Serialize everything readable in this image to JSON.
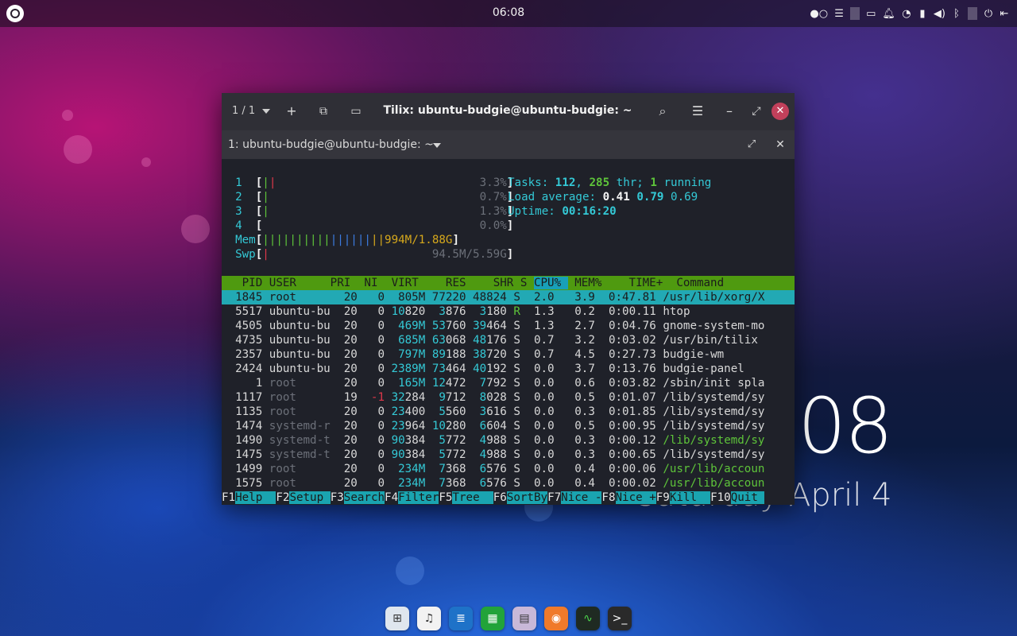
{
  "top_panel": {
    "clock": "06:08",
    "logo_icon": "budgie-menu-icon",
    "tray_icons": [
      "workspace-dots-icon",
      "raven-menu-icon",
      "folder-icon",
      "bell-icon",
      "wifi-icon",
      "battery-icon",
      "volume-icon",
      "bluetooth-icon",
      "power-icon",
      "exit-icon"
    ]
  },
  "desktop_clock": {
    "time": "08",
    "date": "Saturday April  4"
  },
  "window": {
    "session_counter": "1 / 1",
    "title": "Tilix: ubuntu-budgie@ubuntu-budgie: ~",
    "terminal_title": "1: ubuntu-budgie@ubuntu-budgie: ~"
  },
  "htop": {
    "cpus": [
      {
        "n": "1",
        "bars": "|",
        "bars2": "|",
        "pct": "3.3%"
      },
      {
        "n": "2",
        "bars": "|",
        "bars2": "",
        "pct": "0.7%"
      },
      {
        "n": "3",
        "bars": "|",
        "bars2": "",
        "pct": "1.3%"
      },
      {
        "n": "4",
        "bars": "",
        "bars2": "",
        "pct": "0.0%"
      }
    ],
    "mem": {
      "label": "Mem",
      "bars": "||||||||||||||||||",
      "value": "994M/1.88G"
    },
    "swp": {
      "label": "Swp",
      "bars": "|",
      "value": "94.5M/5.59G"
    },
    "tasks": {
      "label": "Tasks:",
      "count": "112",
      "thr": "285",
      "thr_label": " thr;",
      "running": "1",
      "running_label": " running"
    },
    "load": {
      "label": "Load average:",
      "v1": "0.41",
      "v2": "0.79",
      "v3": "0.69"
    },
    "uptime": {
      "label": "Uptime:",
      "value": "00:16:20"
    },
    "columns": [
      "PID",
      "USER",
      "PRI",
      "NI",
      "VIRT",
      "RES",
      "SHR",
      "S",
      "CPU%",
      "MEM%",
      "TIME+",
      "Command"
    ],
    "processes": [
      {
        "pid": "1845",
        "user": "root",
        "pri": "20",
        "ni": "0",
        "virt": "805M",
        "res": "77220",
        "shr": "48824",
        "s": "S",
        "cpu": "2.0",
        "mem": "3.9",
        "time": "0:47.81",
        "cmd": "/usr/lib/xorg/X"
      },
      {
        "pid": "5517",
        "user": "ubuntu-bu",
        "pri": "20",
        "ni": "0",
        "virt": "10820",
        "res": "3876",
        "shr": "3180",
        "s": "R",
        "cpu": "1.3",
        "mem": "0.2",
        "time": "0:00.11",
        "cmd": "htop"
      },
      {
        "pid": "4505",
        "user": "ubuntu-bu",
        "pri": "20",
        "ni": "0",
        "virt": "469M",
        "res": "53760",
        "shr": "39464",
        "s": "S",
        "cpu": "1.3",
        "mem": "2.7",
        "time": "0:04.76",
        "cmd": "gnome-system-mo"
      },
      {
        "pid": "4735",
        "user": "ubuntu-bu",
        "pri": "20",
        "ni": "0",
        "virt": "685M",
        "res": "63068",
        "shr": "48176",
        "s": "S",
        "cpu": "0.7",
        "mem": "3.2",
        "time": "0:03.02",
        "cmd": "/usr/bin/tilix"
      },
      {
        "pid": "2357",
        "user": "ubuntu-bu",
        "pri": "20",
        "ni": "0",
        "virt": "797M",
        "res": "89188",
        "shr": "38720",
        "s": "S",
        "cpu": "0.7",
        "mem": "4.5",
        "time": "0:27.73",
        "cmd": "budgie-wm"
      },
      {
        "pid": "2424",
        "user": "ubuntu-bu",
        "pri": "20",
        "ni": "0",
        "virt": "2389M",
        "res": "73464",
        "shr": "40192",
        "s": "S",
        "cpu": "0.0",
        "mem": "3.7",
        "time": "0:13.76",
        "cmd": "budgie-panel"
      },
      {
        "pid": "1",
        "user": "root",
        "pri": "20",
        "ni": "0",
        "virt": "165M",
        "res": "12472",
        "shr": "7792",
        "s": "S",
        "cpu": "0.0",
        "mem": "0.6",
        "time": "0:03.82",
        "cmd": "/sbin/init spla"
      },
      {
        "pid": "1117",
        "user": "root",
        "pri": "19",
        "ni": "-1",
        "virt": "32284",
        "res": "9712",
        "shr": "8028",
        "s": "S",
        "cpu": "0.0",
        "mem": "0.5",
        "time": "0:01.07",
        "cmd": "/lib/systemd/sy"
      },
      {
        "pid": "1135",
        "user": "root",
        "pri": "20",
        "ni": "0",
        "virt": "23400",
        "res": "5560",
        "shr": "3616",
        "s": "S",
        "cpu": "0.0",
        "mem": "0.3",
        "time": "0:01.85",
        "cmd": "/lib/systemd/sy"
      },
      {
        "pid": "1474",
        "user": "systemd-r",
        "pri": "20",
        "ni": "0",
        "virt": "23964",
        "res": "10280",
        "shr": "6604",
        "s": "S",
        "cpu": "0.0",
        "mem": "0.5",
        "time": "0:00.95",
        "cmd": "/lib/systemd/sy"
      },
      {
        "pid": "1490",
        "user": "systemd-t",
        "pri": "20",
        "ni": "0",
        "virt": "90384",
        "res": "5772",
        "shr": "4988",
        "s": "S",
        "cpu": "0.0",
        "mem": "0.3",
        "time": "0:00.12",
        "cmd": "/lib/systemd/sy"
      },
      {
        "pid": "1475",
        "user": "systemd-t",
        "pri": "20",
        "ni": "0",
        "virt": "90384",
        "res": "5772",
        "shr": "4988",
        "s": "S",
        "cpu": "0.0",
        "mem": "0.3",
        "time": "0:00.65",
        "cmd": "/lib/systemd/sy"
      },
      {
        "pid": "1499",
        "user": "root",
        "pri": "20",
        "ni": "0",
        "virt": "234M",
        "res": "7368",
        "shr": "6576",
        "s": "S",
        "cpu": "0.0",
        "mem": "0.4",
        "time": "0:00.06",
        "cmd": "/usr/lib/accoun"
      },
      {
        "pid": "1575",
        "user": "root",
        "pri": "20",
        "ni": "0",
        "virt": "234M",
        "res": "7368",
        "shr": "6576",
        "s": "S",
        "cpu": "0.0",
        "mem": "0.4",
        "time": "0:00.02",
        "cmd": "/usr/lib/accoun"
      }
    ],
    "fkeys": [
      {
        "key": "F1",
        "label": "Help  "
      },
      {
        "key": "F2",
        "label": "Setup "
      },
      {
        "key": "F3",
        "label": "Search"
      },
      {
        "key": "F4",
        "label": "Filter"
      },
      {
        "key": "F5",
        "label": "Tree  "
      },
      {
        "key": "F6",
        "label": "SortBy"
      },
      {
        "key": "F7",
        "label": "Nice -"
      },
      {
        "key": "F8",
        "label": "Nice +"
      },
      {
        "key": "F9",
        "label": "Kill  "
      },
      {
        "key": "F10",
        "label": "Quit "
      }
    ]
  },
  "dock": [
    {
      "name": "app-grid-icon",
      "color": "#dfe6ee"
    },
    {
      "name": "music-icon",
      "color": "#f2f2f2"
    },
    {
      "name": "writer-icon",
      "color": "#1e72c8"
    },
    {
      "name": "calc-icon",
      "color": "#22a33a"
    },
    {
      "name": "files-icon",
      "color": "#c8b8d8"
    },
    {
      "name": "firefox-icon",
      "color": "#f07a2a"
    },
    {
      "name": "system-monitor-icon",
      "color": "#1f2a22"
    },
    {
      "name": "terminal-icon",
      "color": "#2a2a2a"
    }
  ]
}
